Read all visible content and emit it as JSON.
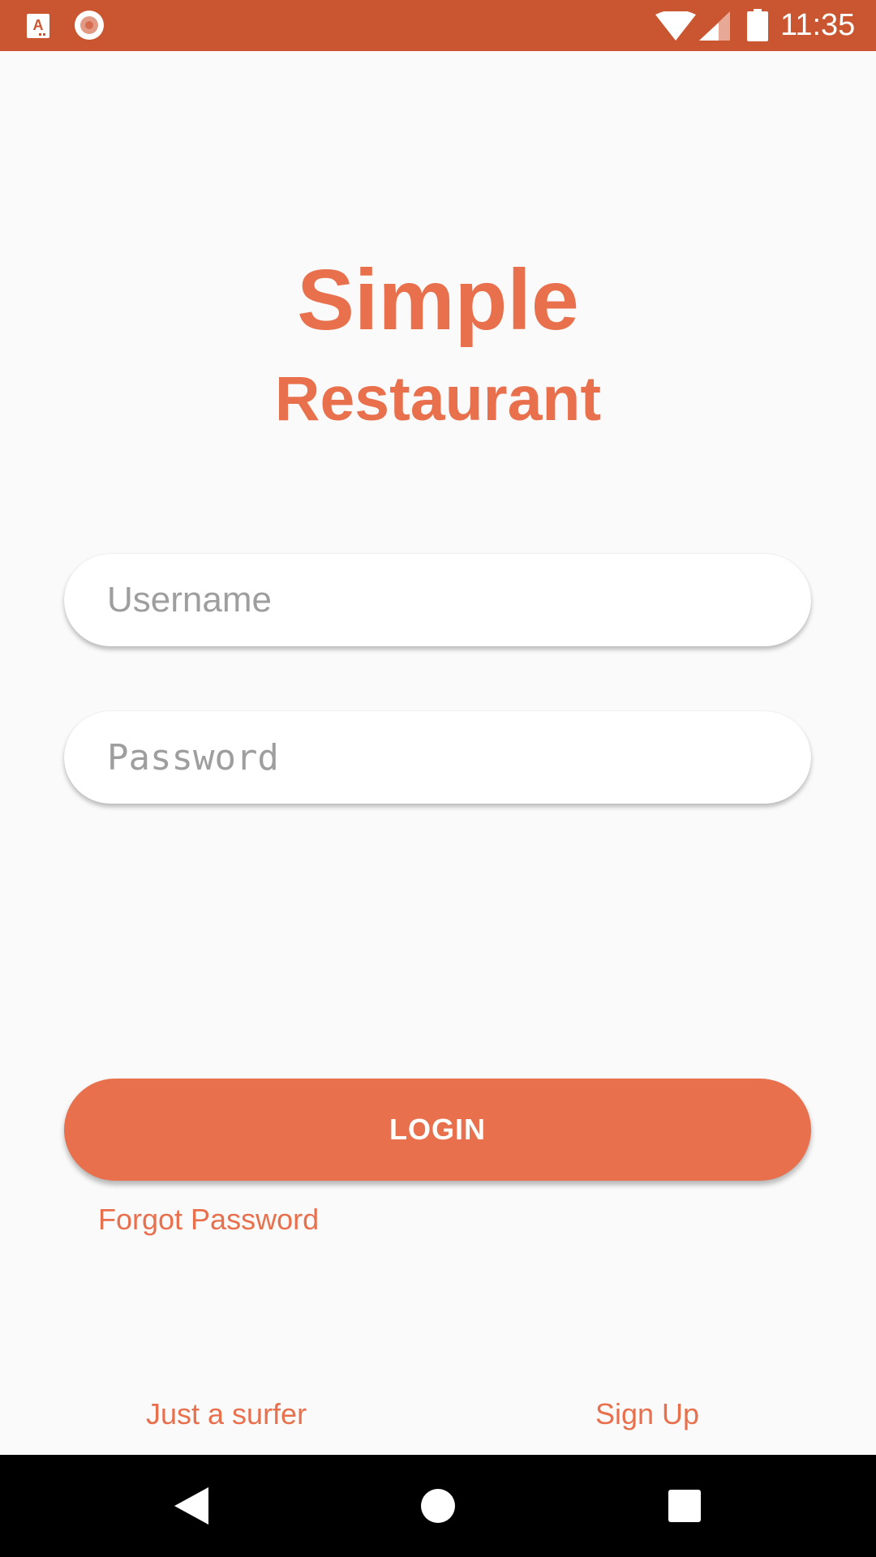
{
  "status_bar": {
    "time": "11:35",
    "background_color": "#c95631",
    "icons": [
      "app-notification-icon",
      "record-icon",
      "wifi-icon",
      "cellular-signal-icon",
      "battery-icon"
    ]
  },
  "header": {
    "title": "Simple",
    "subtitle": "Restaurant",
    "accent_color": "#e8704d"
  },
  "form": {
    "username": {
      "value": "",
      "placeholder": "Username"
    },
    "password": {
      "value": "",
      "placeholder": "Password"
    },
    "login_label": "LOGIN",
    "forgot_password_label": "Forgot Password"
  },
  "footer": {
    "guest_label": "Just a surfer",
    "signup_label": "Sign Up"
  },
  "nav_bar": {
    "icons": [
      "back-icon",
      "home-icon",
      "recents-icon"
    ]
  }
}
